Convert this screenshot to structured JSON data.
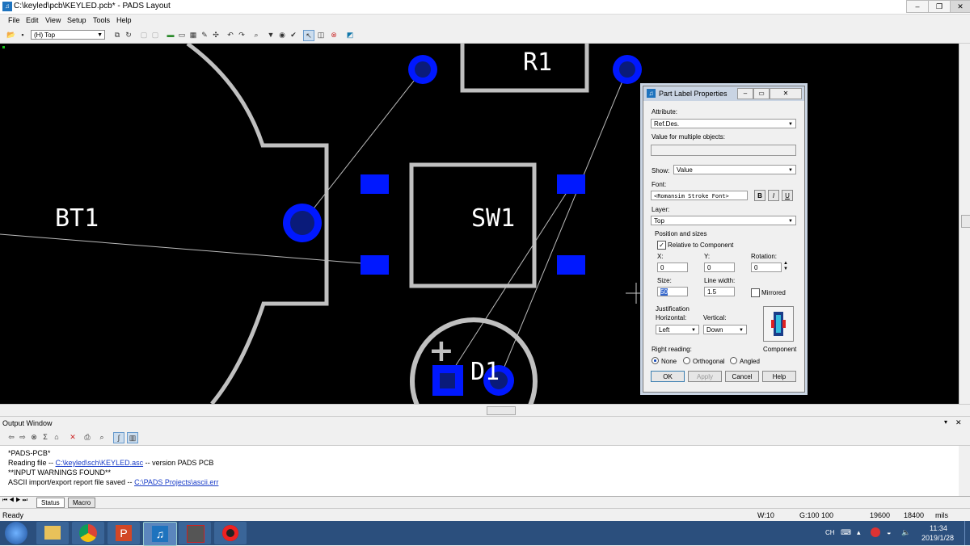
{
  "window": {
    "title": "C:\\keyled\\pcb\\KEYLED.pcb* - PADS Layout",
    "min": "–",
    "max": "❐",
    "close": "✕"
  },
  "menu": [
    "File",
    "Edit",
    "View",
    "Setup",
    "Tools",
    "Help"
  ],
  "toolbar": {
    "layer": "(H) Top"
  },
  "board": {
    "labels": {
      "bt1": "BT1",
      "sw1": "SW1",
      "r1": "R1",
      "d1": "D1",
      "plus": "+"
    }
  },
  "dialog": {
    "title": "Part Label Properties",
    "attribute_label": "Attribute:",
    "attribute_value": "Ref.Des.",
    "multi_label": "Value for multiple objects:",
    "multi_value": "",
    "show_label": "Show:",
    "show_value": "Value",
    "font_label": "Font:",
    "font_value": "<Romansim Stroke Font>",
    "bold": "B",
    "italic": "I",
    "underline": "U",
    "layer_label": "Layer:",
    "layer_value": "Top",
    "pos_group": "Position and sizes",
    "relative_label": "Relative to Component",
    "relative_checked": true,
    "x_label": "X:",
    "x_value": "0",
    "y_label": "Y:",
    "y_value": "0",
    "rot_label": "Rotation:",
    "rot_value": "0",
    "size_label": "Size:",
    "size_value": "50",
    "lw_label": "Line width:",
    "lw_value": "1.5",
    "mirrored_label": "Mirrored",
    "mirrored_checked": false,
    "just_label": "Justification",
    "horiz_label": "Horizontal:",
    "horiz_value": "Left",
    "vert_label": "Vertical:",
    "vert_value": "Down",
    "component_label": "Component",
    "rr_label": "Right reading:",
    "rr_none": "None",
    "rr_ortho": "Orthogonal",
    "rr_angled": "Angled",
    "rr_selected": "None",
    "ok": "OK",
    "apply": "Apply",
    "cancel": "Cancel",
    "help": "Help"
  },
  "output": {
    "title": "Output Window",
    "lines": [
      {
        "text": "*PADS-PCB*",
        "pre": "",
        "link": "",
        "post": ""
      },
      {
        "pre": "Reading file -- ",
        "link": "C:\\keyled\\sch\\KEYLED.asc",
        "post": "  -- version PADS PCB"
      },
      {
        "text": "**INPUT WARNINGS FOUND**"
      },
      {
        "pre": "ASCII import/export report file saved -- ",
        "link": "C:\\PADS Projects\\ascii.err",
        "post": ""
      }
    ],
    "tabs": [
      "Status",
      "Macro"
    ]
  },
  "status": {
    "ready": "Ready",
    "w": "W:10",
    "g": "G:100 100",
    "x": "19600",
    "y": "18400",
    "units": "mils"
  },
  "taskbar": {
    "lang": "CH",
    "time": "11:34",
    "date": "2019/1/28"
  },
  "colors": {
    "pad": "#0018ff",
    "via": "#0a1bd0",
    "outline": "#c0c0c0",
    "board": "#000000"
  }
}
